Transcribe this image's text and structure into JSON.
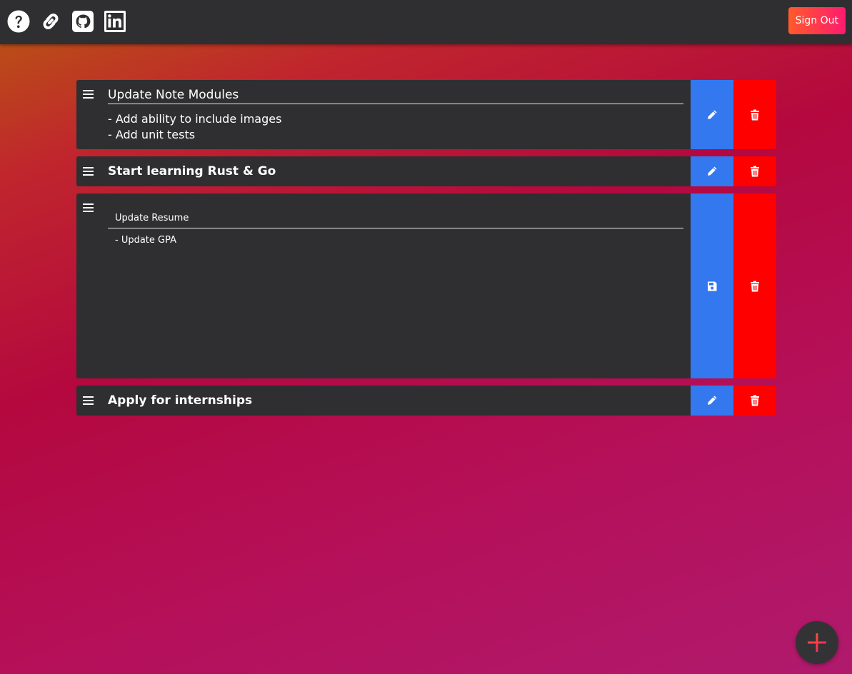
{
  "header": {
    "icons": [
      "question-circle-icon",
      "link-icon",
      "github-icon",
      "linkedin-icon"
    ],
    "signout_label": "Sign Out"
  },
  "notes": [
    {
      "title": "Update Note Modules",
      "content": "- Add ability to include images\n- Add unit tests",
      "mode": "view",
      "primary_action_icon": "pencil-icon",
      "secondary_action_icon": "trash-icon"
    },
    {
      "title": "Start learning Rust & Go",
      "content": "",
      "mode": "view",
      "primary_action_icon": "pencil-icon",
      "secondary_action_icon": "trash-icon"
    },
    {
      "title": "Update Resume",
      "content": "- Update GPA",
      "mode": "edit",
      "primary_action_icon": "save-icon",
      "secondary_action_icon": "trash-icon"
    },
    {
      "title": "Apply for internships",
      "content": "",
      "mode": "view",
      "primary_action_icon": "pencil-icon",
      "secondary_action_icon": "trash-icon"
    }
  ],
  "fab": {
    "icon": "plus-icon"
  },
  "colors": {
    "edit_button": "#3478f0",
    "delete_button": "#ff0000",
    "card": "#2f2f31",
    "topbar": "#2f2f31"
  }
}
